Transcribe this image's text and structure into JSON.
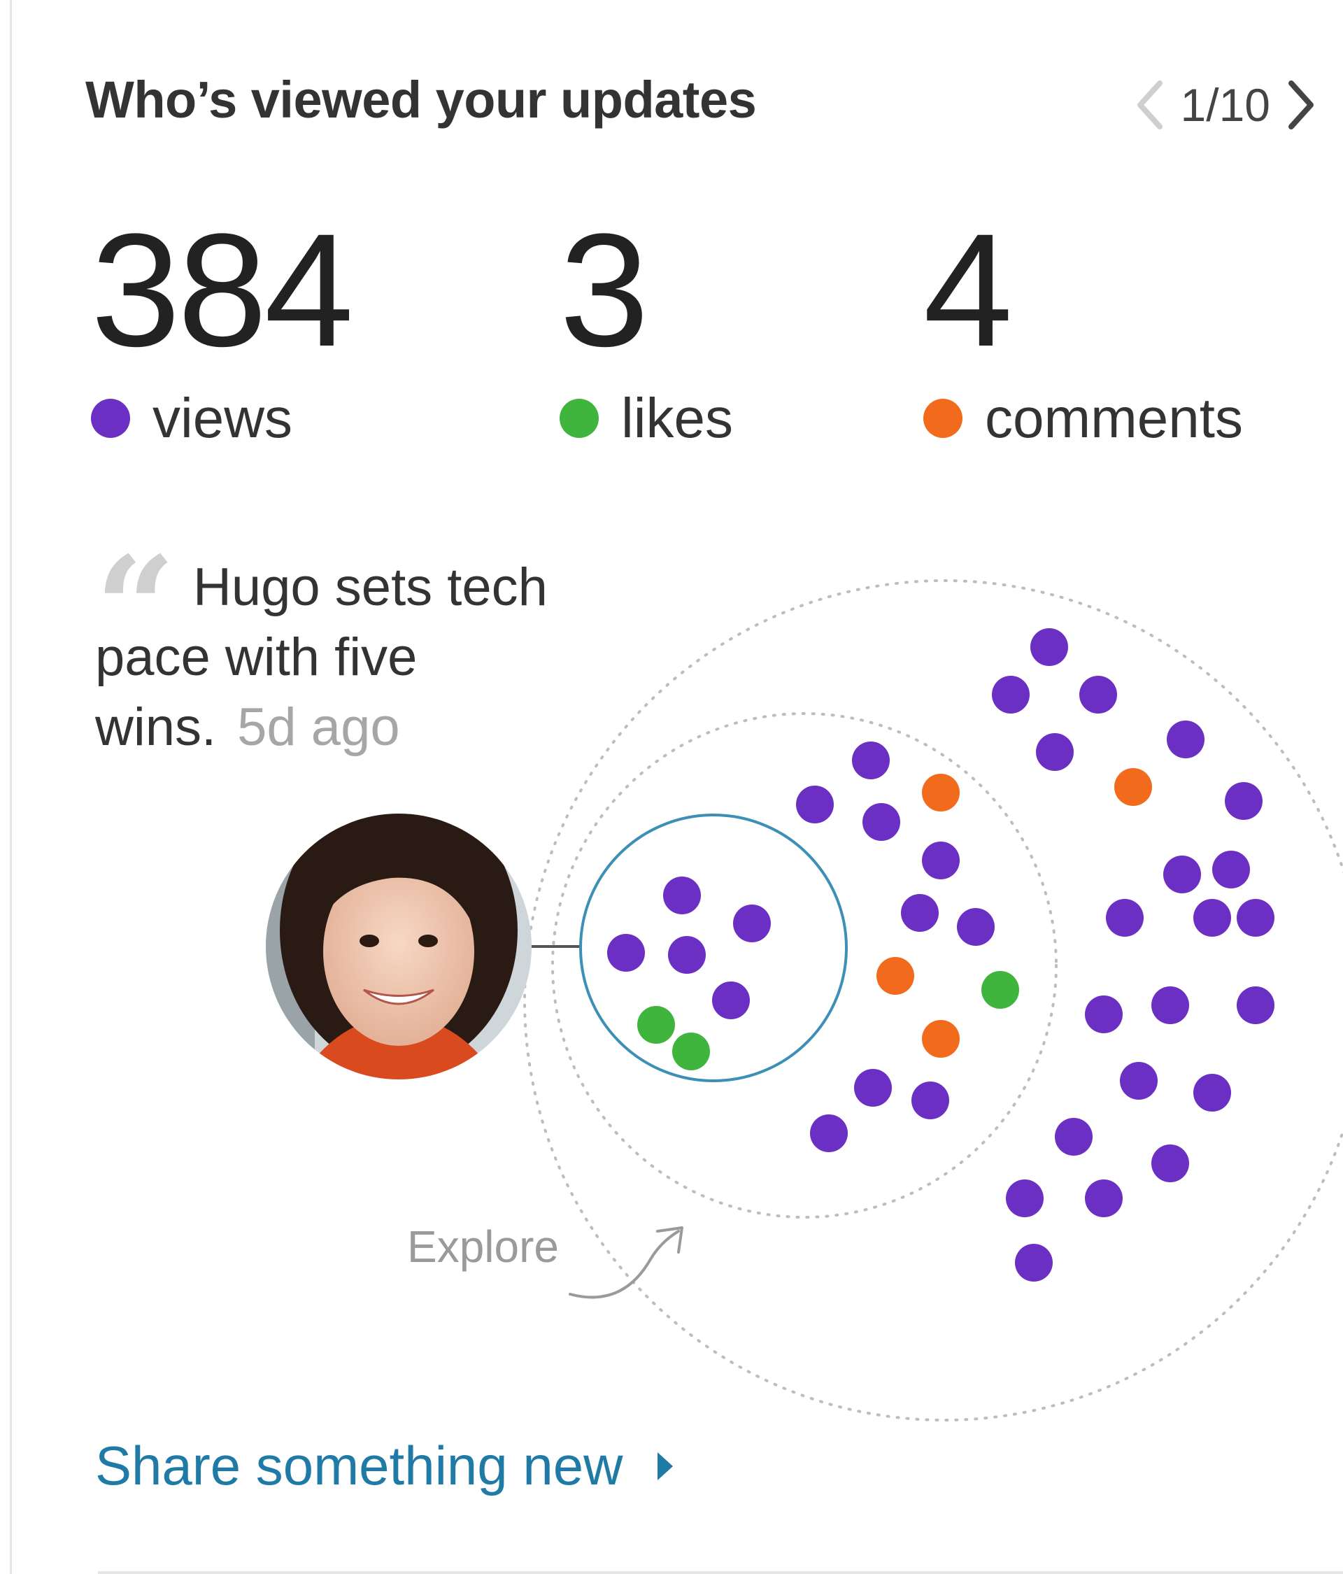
{
  "header": {
    "title": "Who’s viewed your updates",
    "pager": "1/10"
  },
  "stats": [
    {
      "value": "384",
      "label": "views",
      "color": "#6b2fc4"
    },
    {
      "value": "3",
      "label": "likes",
      "color": "#3fb53d"
    },
    {
      "value": "4",
      "label": "comments",
      "color": "#f26b1d"
    }
  ],
  "update": {
    "text": "Hugo sets tech pace with five wins.",
    "time": "5d ago"
  },
  "network": {
    "explore_label": "Explore",
    "colors": {
      "view": "#6b2fc4",
      "like": "#3fb53d",
      "comment": "#f26b1d",
      "ring": "#3c8fb5"
    }
  },
  "footer": {
    "share_label": "Share something new"
  }
}
